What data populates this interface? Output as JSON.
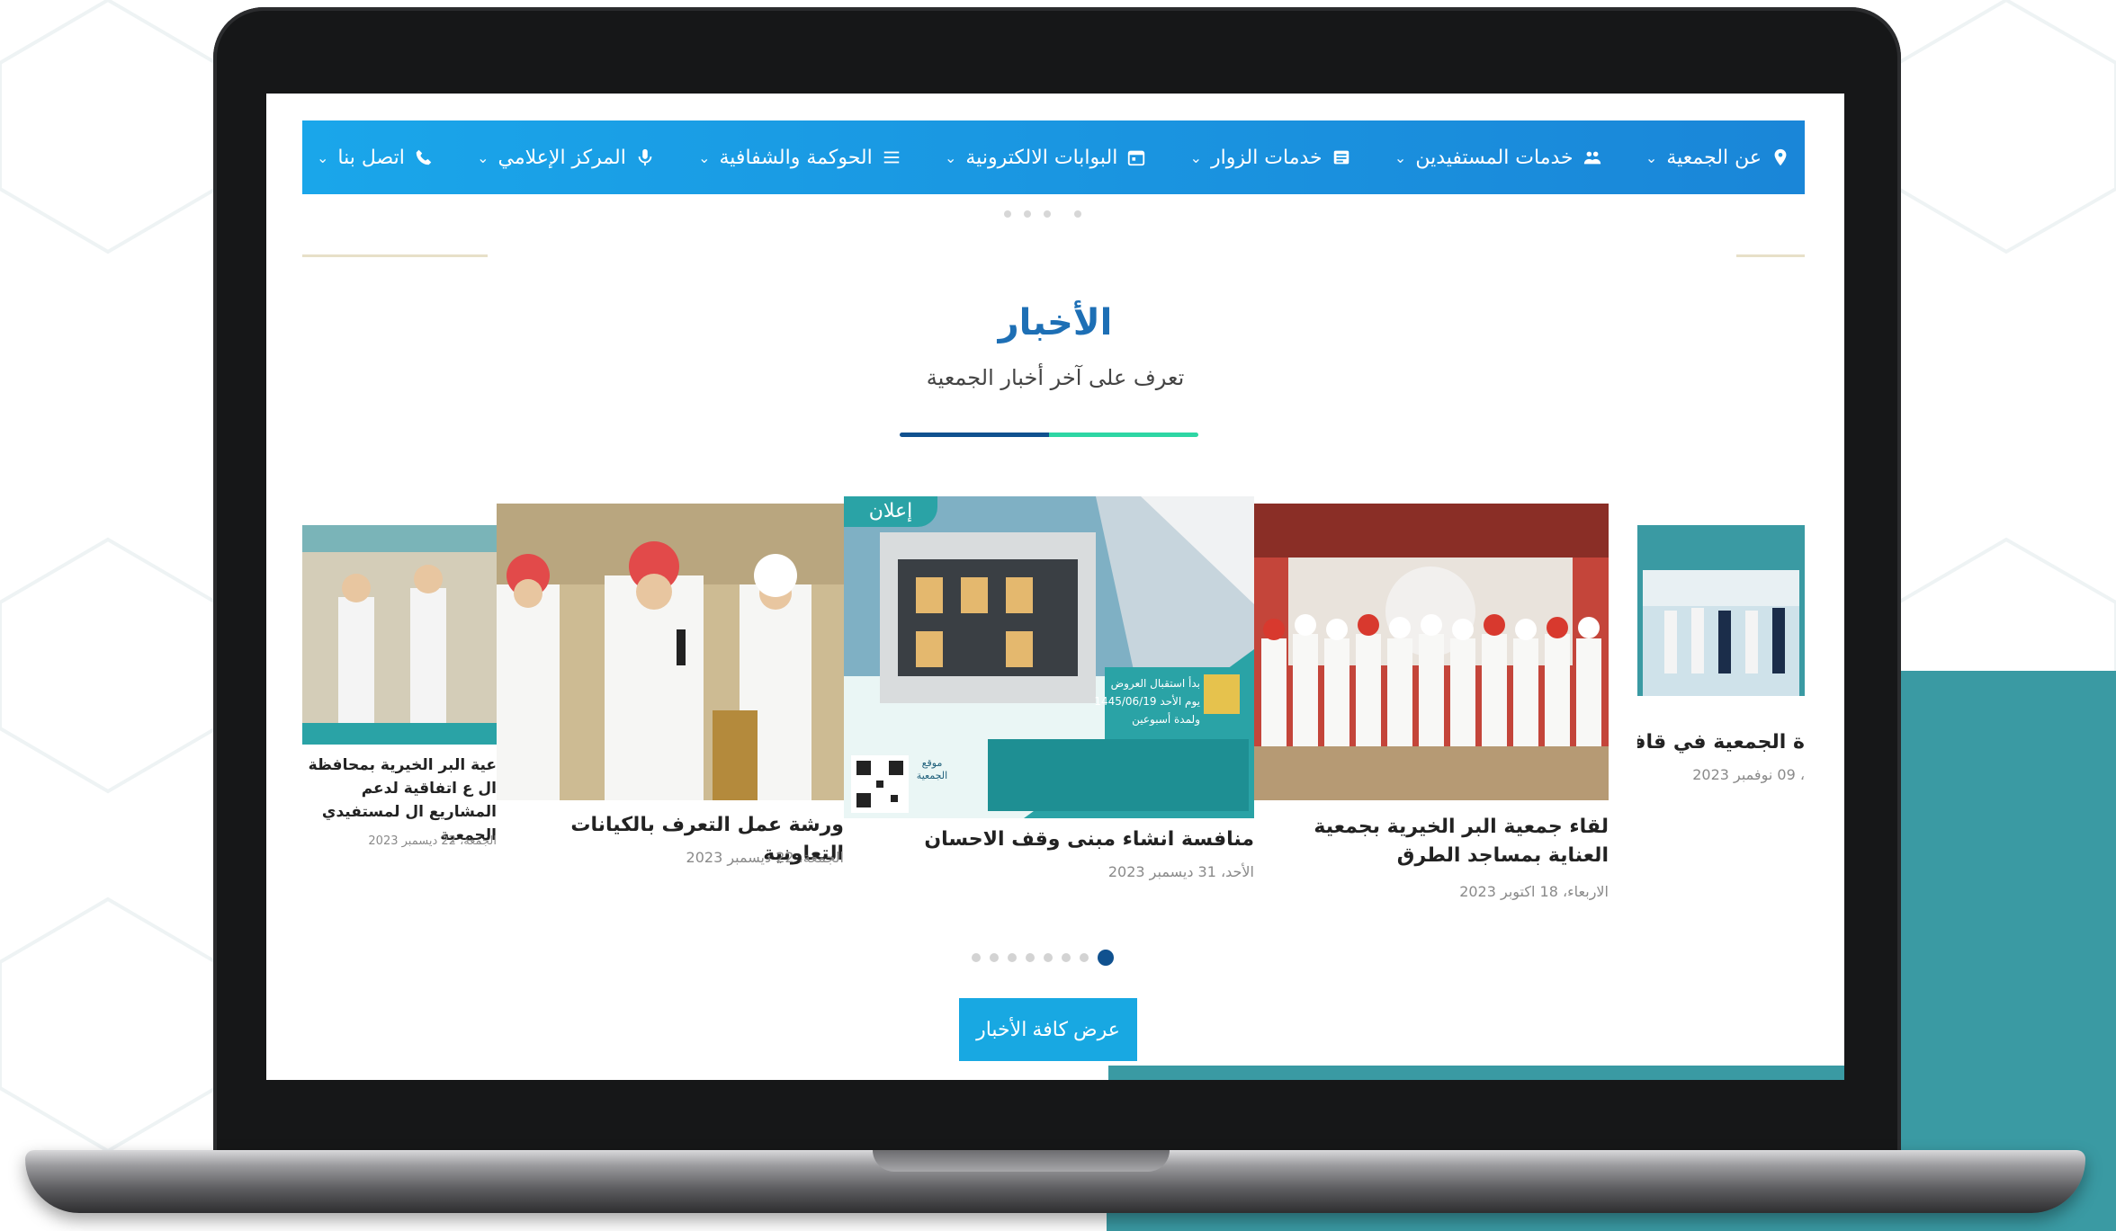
{
  "nav": {
    "items": [
      {
        "label": "عن الجمعية",
        "icon": "info-pin-icon"
      },
      {
        "label": "خدمات المستفيدين",
        "icon": "users-icon"
      },
      {
        "label": "خدمات الزوار",
        "icon": "id-card-icon"
      },
      {
        "label": "البوابات الالكترونية",
        "icon": "calendar-icon"
      },
      {
        "label": "الحوكمة والشفافية",
        "icon": "menu-icon"
      },
      {
        "label": "المركز الإعلامي",
        "icon": "microphone-icon"
      },
      {
        "label": "اتصل بنا",
        "icon": "phone-icon"
      }
    ],
    "chevron": "⌄"
  },
  "news": {
    "title": "الأخبار",
    "subtitle": "تعرف على آخر أخبار الجمعية",
    "cards": [
      {
        "title": "ة الجمعية في قافلة نماء",
        "date": "، 09 نوفمبر 2023"
      },
      {
        "title": "لقاء جمعية البر الخيرية بجمعية العناية بمساجد الطرق",
        "date": "الاربعاء، 18 اكتوبر 2023"
      },
      {
        "title": "منافسة انشاء مبنى وقف الاحسان",
        "date": "الأحد، 31 ديسمبر 2023",
        "badge": "إعلان"
      },
      {
        "title": "ورشة عمل التعرف بالكيانات التعاونية",
        "date": "الجمعة، 22 ديسمبر 2023"
      },
      {
        "title": "عية البر الخيرية بمحافظة ال ع اتفاقية لدعم المشاريع ال لمستفيدي الجمعية",
        "date": "الجمعة، 22 ديسمبر 2023"
      }
    ],
    "flyer": {
      "line1": "بدأ استقبال العروض",
      "line2": "يوم الأحد 1445/06/19",
      "line3": "ولمدة أسبوعين",
      "site_label": "موقع الجمعية"
    },
    "button_label": "عرض كافة الأخبار"
  },
  "slider": {
    "dot_count": 8,
    "active_index": 7
  },
  "colors": {
    "nav_start": "#1aa6ea",
    "nav_end": "#1a86d8",
    "title": "#1d6fb5",
    "accent_dark": "#10518f",
    "accent_green": "#2ed6a4",
    "teal": "#3a9aa3",
    "button": "#18a8e2"
  }
}
